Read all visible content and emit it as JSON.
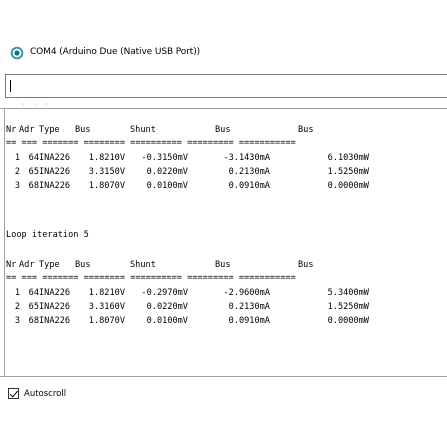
{
  "window": {
    "title": "COM4 (Arduino Due (Native USB Port))"
  },
  "input": {
    "value": "",
    "placeholder": ""
  },
  "output": {
    "dots": "·  ·  ·",
    "blocks": [
      {
        "headers": [
          "Nr",
          "Adr",
          "Type",
          "Bus",
          "Shunt",
          "Bus",
          "Bus"
        ],
        "separator": "== === ======= ======== ========== ========= ===========",
        "rows": [
          [
            "1",
            "64",
            "INA226",
            "1.8210V",
            "-0.3150mV",
            "-3.1430mA",
            "6.1030mW"
          ],
          [
            "2",
            "65",
            "INA226",
            "3.3150V",
            "0.0220mV",
            "0.2130mA",
            "1.5250mW"
          ],
          [
            "3",
            "68",
            "INA226",
            "1.8070V",
            "0.0100mV",
            "0.0910mA",
            "0.0000mW"
          ]
        ]
      },
      {
        "label": "Loop iteration 5",
        "headers": [
          "Nr",
          "Adr",
          "Type",
          "Bus",
          "Shunt",
          "Bus",
          "Bus"
        ],
        "separator": "== === ======= ======== ========== ========= ===========",
        "rows": [
          [
            "1",
            "64",
            "INA226",
            "1.8210V",
            "-0.2970mV",
            "-2.9600mA",
            "5.3400mW"
          ],
          [
            "2",
            "65",
            "INA226",
            "3.3160V",
            "0.0220mV",
            "0.2130mA",
            "1.5250mW"
          ],
          [
            "3",
            "68",
            "INA226",
            "1.8070V",
            "0.0100mV",
            "0.0910mA",
            "0.0000mW"
          ]
        ]
      }
    ]
  },
  "footer": {
    "autoscroll_label": "Autoscroll",
    "autoscroll_checked": true
  },
  "colors": {
    "icon_ring": "#3fa9a3",
    "icon_center": "#1a6e8e",
    "border": "#a0a0a0"
  }
}
